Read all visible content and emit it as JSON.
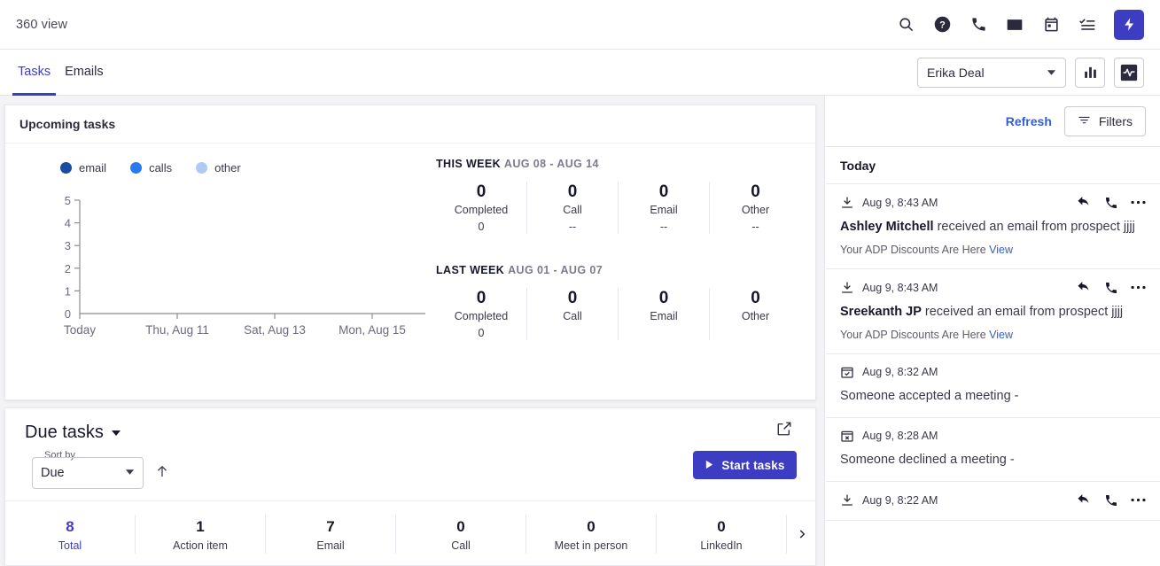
{
  "header": {
    "title": "360 view",
    "icons": [
      {
        "name": "search-icon"
      },
      {
        "name": "help-icon"
      },
      {
        "name": "phone-icon"
      },
      {
        "name": "mail-icon"
      },
      {
        "name": "calendar-icon"
      },
      {
        "name": "tasks-list-icon"
      }
    ],
    "action_button": {
      "name": "lightning-bolt-button"
    },
    "accent_color": "#3d3dc4"
  },
  "tabbar": {
    "tabs": [
      {
        "label": "Tasks",
        "active": true
      },
      {
        "label": "Emails",
        "active": false
      }
    ],
    "person_select": {
      "value": "Erika Deal"
    },
    "chart_button": {
      "name": "bar-chart-button"
    },
    "activity_button": {
      "name": "activity-monitor-button"
    }
  },
  "upcoming_card": {
    "title": "Upcoming tasks",
    "legend": [
      {
        "label": "email",
        "color": "#1a4d9e"
      },
      {
        "label": "calls",
        "color": "#2979f0"
      },
      {
        "label": "other",
        "color": "#aecbf5"
      }
    ],
    "this_week": {
      "title": "THIS WEEK",
      "range": "AUG 08 - AUG 14",
      "stats": [
        {
          "num": "0",
          "label": "Completed",
          "sub": "0"
        },
        {
          "num": "0",
          "label": "Call",
          "sub": "--"
        },
        {
          "num": "0",
          "label": "Email",
          "sub": "--"
        },
        {
          "num": "0",
          "label": "Other",
          "sub": "--"
        }
      ]
    },
    "last_week": {
      "title": "LAST WEEK",
      "range": "AUG 01 - AUG 07",
      "stats": [
        {
          "num": "0",
          "label": "Completed",
          "sub": "0"
        },
        {
          "num": "0",
          "label": "Call",
          "sub": ""
        },
        {
          "num": "0",
          "label": "Email",
          "sub": ""
        },
        {
          "num": "0",
          "label": "Other",
          "sub": ""
        }
      ]
    }
  },
  "chart_data": {
    "type": "bar",
    "title": "Upcoming tasks",
    "xlabel": "",
    "ylabel": "",
    "categories": [
      "Today",
      "Thu, Aug 11",
      "Sat, Aug 13",
      "Mon, Aug 15"
    ],
    "x_tick_labels": [
      "Today",
      "Thu, Aug 11",
      "Sat, Aug 13",
      "Mon, Aug 15"
    ],
    "y_tick_labels": [
      "5",
      "4",
      "3",
      "2",
      "1",
      "0"
    ],
    "ylim": [
      0,
      5
    ],
    "grid": false,
    "legend_position": "top-left",
    "series": [
      {
        "name": "email",
        "color": "#1a4d9e",
        "values": [
          0,
          0,
          0,
          0
        ]
      },
      {
        "name": "calls",
        "color": "#2979f0",
        "values": [
          0,
          0,
          0,
          0
        ]
      },
      {
        "name": "other",
        "color": "#aecbf5",
        "values": [
          0,
          0,
          0,
          0
        ]
      }
    ]
  },
  "due_panel": {
    "title": "Due tasks",
    "sort_by_label": "Sort by",
    "sort_by_value": "Due",
    "sort_direction": "ascending",
    "start_button": "Start tasks",
    "stats": [
      {
        "num": "8",
        "label": "Total",
        "active": true
      },
      {
        "num": "1",
        "label": "Action item",
        "active": false
      },
      {
        "num": "7",
        "label": "Email",
        "active": false
      },
      {
        "num": "0",
        "label": "Call",
        "active": false
      },
      {
        "num": "0",
        "label": "Meet in person",
        "active": false
      },
      {
        "num": "0",
        "label": "LinkedIn",
        "active": false
      }
    ]
  },
  "activity_panel": {
    "refresh_label": "Refresh",
    "filters_label": "Filters",
    "section_title": "Today",
    "items": [
      {
        "icon": "inbox-download-icon",
        "time": "Aug 9, 8:43 AM",
        "actor": "Ashley Mitchell",
        "text": " received an email from prospect jjjj",
        "sub": "Your ADP Discounts Are Here",
        "sub_link": "View",
        "has_actions": true
      },
      {
        "icon": "inbox-download-icon",
        "time": "Aug 9, 8:43 AM",
        "actor": "Sreekanth JP",
        "text": " received an email from prospect jjjj",
        "sub": "Your ADP Discounts Are Here",
        "sub_link": "View",
        "has_actions": true
      },
      {
        "icon": "calendar-check-icon",
        "time": "Aug 9, 8:32 AM",
        "actor": "",
        "text": "Someone accepted a meeting -",
        "sub": "",
        "sub_link": "",
        "has_actions": false
      },
      {
        "icon": "calendar-x-icon",
        "time": "Aug 9, 8:28 AM",
        "actor": "",
        "text": "Someone declined a meeting -",
        "sub": "",
        "sub_link": "",
        "has_actions": false
      },
      {
        "icon": "inbox-download-icon",
        "time": "Aug 9, 8:22 AM",
        "actor": "",
        "text": "",
        "sub": "",
        "sub_link": "",
        "has_actions": true
      }
    ]
  }
}
